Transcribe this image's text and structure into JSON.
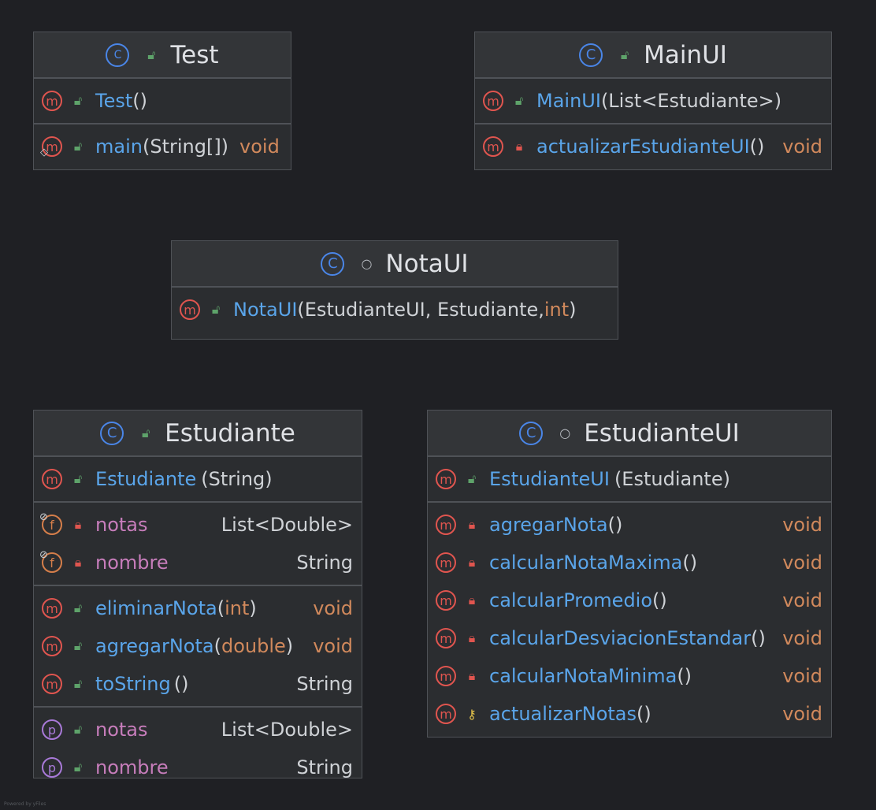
{
  "classes": {
    "test": {
      "title": "Test",
      "ctor": {
        "name": "Test",
        "params": "()"
      },
      "main": {
        "name": "main",
        "params": "(String[])",
        "ret": "void"
      }
    },
    "mainui": {
      "title": "MainUI",
      "ctor": {
        "name": "MainUI",
        "params": "(List<Estudiante>)"
      },
      "m1": {
        "name": "actualizarEstudianteUI",
        "params": "()",
        "ret": "void"
      }
    },
    "notaui": {
      "title": "NotaUI",
      "ctor": {
        "name": "NotaUI",
        "params_a": "(EstudianteUI, Estudiante, ",
        "params_prim": "int",
        "params_b": ")"
      }
    },
    "estudiante": {
      "title": "Estudiante",
      "ctor": {
        "name": "Estudiante",
        "params": "(String)"
      },
      "fields": [
        {
          "name": "notas",
          "type": "List<Double>"
        },
        {
          "name": "nombre",
          "type": "String"
        }
      ],
      "methods": [
        {
          "name": "eliminarNota",
          "params_a": "(",
          "params_prim": "int",
          "params_b": ")",
          "ret": "void"
        },
        {
          "name": "agregarNota",
          "params_a": "(",
          "params_prim": "double",
          "params_b": ")",
          "ret": "void"
        },
        {
          "name": "toString",
          "params_a": "()",
          "params_prim": "",
          "params_b": "",
          "ret": "String"
        }
      ],
      "props": [
        {
          "name": "notas",
          "type": "List<Double>"
        },
        {
          "name": "nombre",
          "type": "String"
        }
      ]
    },
    "estudianteui": {
      "title": "EstudianteUI",
      "ctor": {
        "name": "EstudianteUI",
        "params": "(Estudiante)"
      },
      "methods": [
        {
          "name": "agregarNota",
          "params": "()",
          "ret": "void"
        },
        {
          "name": "calcularNotaMaxima",
          "params": "()",
          "ret": "void"
        },
        {
          "name": "calcularPromedio",
          "params": "()",
          "ret": "void"
        },
        {
          "name": "calcularDesviacionEstandar",
          "params": "()",
          "ret": "void"
        },
        {
          "name": "calcularNotaMinima",
          "params": "()",
          "ret": "void"
        },
        {
          "name": "actualizarNotas",
          "params": "()",
          "ret": "void"
        }
      ]
    }
  },
  "icons": {
    "class_letter": "C",
    "method_letter": "m",
    "field_letter": "f",
    "property_letter": "p",
    "run_glyph": "▶",
    "static_glyph": "◇",
    "final_glyph": "ꝋ",
    "public_glyph": "🔓",
    "private_glyph": "🔒",
    "package_glyph": "○",
    "protected_glyph": "⚷"
  },
  "footer": "Powered by yFiles"
}
